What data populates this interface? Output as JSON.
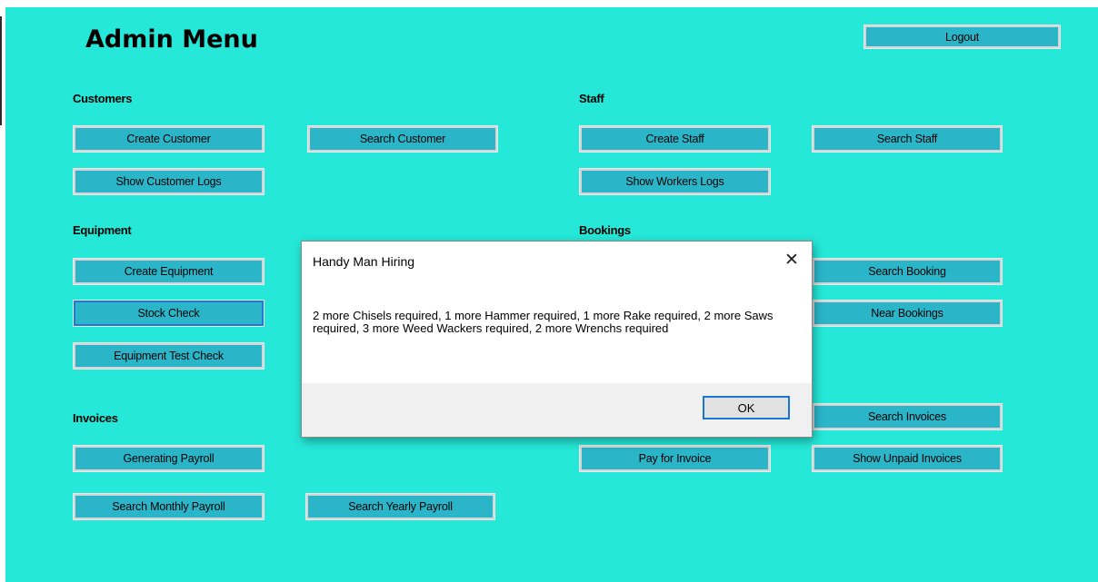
{
  "admin_menu": {
    "title": "Admin Menu",
    "logout_label": "Logout",
    "sections": {
      "customers": "Customers",
      "staff": "Staff",
      "equipment": "Equipment",
      "bookings": "Bookings",
      "invoices": "Invoices"
    },
    "buttons": {
      "create_customer": "Create Customer",
      "search_customer": "Search Customer",
      "show_customer_logs": "Show Customer Logs",
      "create_staff": "Create Staff",
      "search_staff": "Search Staff",
      "show_workers_logs": "Show Workers Logs",
      "create_equipment": "Create Equipment",
      "stock_check": "Stock Check",
      "equipment_test_check": "Equipment Test Check",
      "search_booking": "Search Booking",
      "near_bookings": "Near Bookings",
      "search_invoices": "Search Invoices",
      "pay_for_invoice": "Pay for Invoice",
      "show_unpaid_invoices": "Show Unpaid Invoices",
      "generating_payroll": "Generating Payroll",
      "search_monthly_payroll": "Search Monthly Payroll",
      "search_yearly_payroll": "Search Yearly Payroll"
    }
  },
  "dialog": {
    "title": "Handy Man Hiring",
    "close_glyph": "✕",
    "message": "2 more Chisels required, 1 more Hammer required, 1 more Rake required, 2 more Saws required, 3 more Weed Wackers required, 2 more Wrenchs required",
    "ok_label": "OK"
  },
  "colors": {
    "form_background": "#25e8d8",
    "button_fill": "#2ab5c9",
    "focus_border": "#1e7ad6"
  }
}
